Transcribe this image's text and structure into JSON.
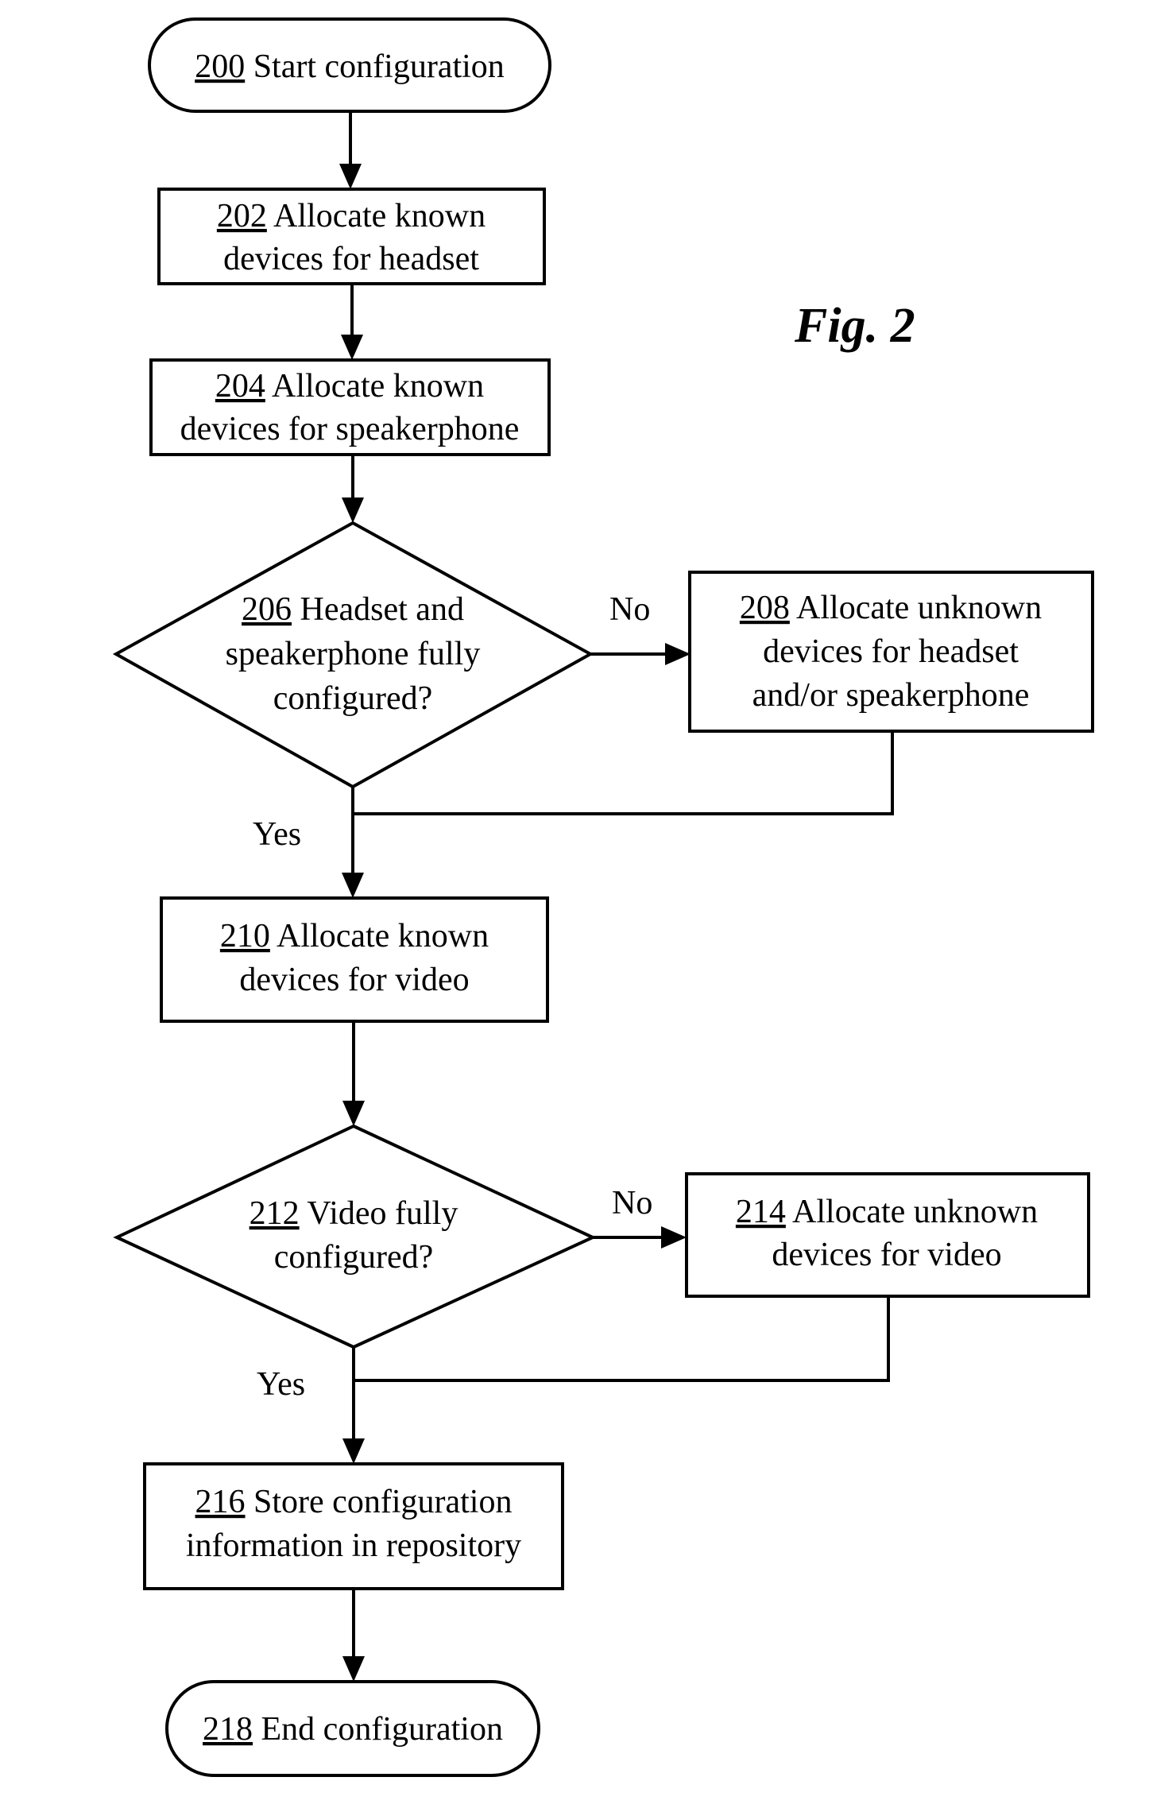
{
  "figure": {
    "label": "Fig. 2",
    "ink_color": "#000000",
    "background_color": "#ffffff"
  },
  "nodes": {
    "n200": {
      "type": "terminator",
      "ref": "200",
      "lines": [
        "Start configuration"
      ]
    },
    "n202": {
      "type": "process",
      "ref": "202",
      "lines": [
        "Allocate known",
        "devices for headset"
      ]
    },
    "n204": {
      "type": "process",
      "ref": "204",
      "lines": [
        "Allocate known",
        "devices for speakerphone"
      ]
    },
    "n206": {
      "type": "decision",
      "ref": "206",
      "lines": [
        "Headset and",
        "speakerphone fully",
        "configured?"
      ]
    },
    "n208": {
      "type": "process",
      "ref": "208",
      "lines": [
        "Allocate unknown",
        "devices for headset",
        "and/or speakerphone"
      ]
    },
    "n210": {
      "type": "process",
      "ref": "210",
      "lines": [
        "Allocate known",
        "devices for video"
      ]
    },
    "n212": {
      "type": "decision",
      "ref": "212",
      "lines": [
        "Video fully",
        "configured?"
      ]
    },
    "n214": {
      "type": "process",
      "ref": "214",
      "lines": [
        "Allocate unknown",
        "devices for video"
      ]
    },
    "n216": {
      "type": "process",
      "ref": "216",
      "lines": [
        "Store configuration",
        "information in repository"
      ]
    },
    "n218": {
      "type": "terminator",
      "ref": "218",
      "lines": [
        "End configuration"
      ]
    }
  },
  "edges": [
    {
      "from": "200",
      "to": "202",
      "label": ""
    },
    {
      "from": "202",
      "to": "204",
      "label": ""
    },
    {
      "from": "204",
      "to": "206",
      "label": ""
    },
    {
      "from": "206",
      "to": "208",
      "label": "No"
    },
    {
      "from": "206",
      "to": "210",
      "label": "Yes"
    },
    {
      "from": "208",
      "to": "210",
      "label": ""
    },
    {
      "from": "210",
      "to": "212",
      "label": ""
    },
    {
      "from": "212",
      "to": "214",
      "label": "No"
    },
    {
      "from": "212",
      "to": "216",
      "label": "Yes"
    },
    {
      "from": "214",
      "to": "216",
      "label": ""
    },
    {
      "from": "216",
      "to": "218",
      "label": ""
    }
  ],
  "edge_labels": {
    "no_206": "No",
    "yes_206": "Yes",
    "no_212": "No",
    "yes_212": "Yes"
  }
}
